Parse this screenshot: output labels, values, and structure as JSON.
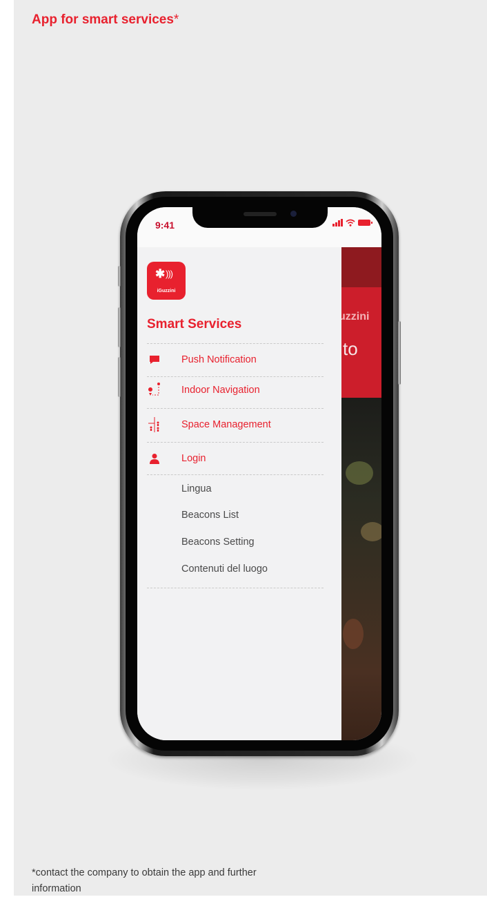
{
  "page": {
    "heading": "App for smart services",
    "heading_asterisk": "*",
    "footnote": "*contact the company to obtain the app and further information"
  },
  "phone": {
    "status_time": "9:41"
  },
  "app": {
    "logo_brand": "iGuzzini",
    "drawer_title": "Smart Services",
    "menu_primary": [
      {
        "label": "Push Notification",
        "icon": "chat-bubble-icon"
      },
      {
        "label": "Indoor Navigation",
        "icon": "route-pin-icon"
      },
      {
        "label": "Space Management",
        "icon": "people-space-icon"
      },
      {
        "label": "Login",
        "icon": "user-icon"
      }
    ],
    "menu_secondary": [
      {
        "label": "Lingua"
      },
      {
        "label": "Beacons List"
      },
      {
        "label": "Beacons Setting"
      },
      {
        "label": "Contenuti del luogo"
      }
    ],
    "background_text_1": "uzzini",
    "background_text_2": "to"
  },
  "colors": {
    "accent": "#e8212e",
    "panel_background": "#ececec",
    "menu_secondary_text": "#4a4a4a"
  }
}
